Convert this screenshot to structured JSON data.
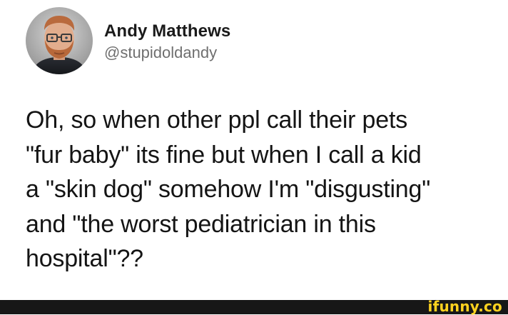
{
  "tweet": {
    "author": {
      "display_name": "Andy Matthews",
      "handle": "@stupidoldandy"
    },
    "text_lines": [
      "Oh, so when other ppl call their pets",
      "\"fur baby\" its fine but when I call a kid",
      "a \"skin dog\" somehow I'm \"disgusting\"",
      "and \"the worst pediatrician in this",
      "hospital\"??"
    ]
  },
  "watermark": {
    "text": "ifunny.co",
    "color": "#ffd21f",
    "bar_color": "#171717"
  },
  "icons": {
    "avatar": "profile-photo"
  }
}
